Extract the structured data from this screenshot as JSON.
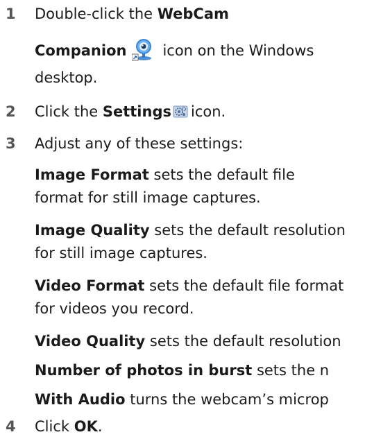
{
  "steps": [
    {
      "num": "1",
      "line1": "Double-click the ",
      "term_a": "WebCam",
      "term_b": "Companion",
      "icon": "webcam-companion-icon",
      "after_icon": "icon on the Windows",
      "line3": "desktop."
    },
    {
      "num": "2",
      "before": "Click the ",
      "term": "Settings",
      "icon": "settings-icon",
      "after": "icon."
    },
    {
      "num": "3",
      "text": "Adjust any of these settings:"
    },
    {
      "num": "4",
      "before": "Click ",
      "term": "OK",
      "after": "."
    }
  ],
  "settings": [
    {
      "term": "Image Format",
      "desc": "sets the default file",
      "desc2": "format for still image captures."
    },
    {
      "term": "Image Quality",
      "desc": "sets the default resolution",
      "desc2": "for still image captures."
    },
    {
      "term": "Video Format",
      "desc": "sets the default file format",
      "desc2": "for videos you record."
    },
    {
      "term": "Video Quality",
      "desc": "sets the default resolution"
    },
    {
      "term": "Number of photos in burst",
      "desc": "sets the n"
    },
    {
      "term": "With Audio",
      "desc": "turns the webcam’s microp"
    }
  ]
}
